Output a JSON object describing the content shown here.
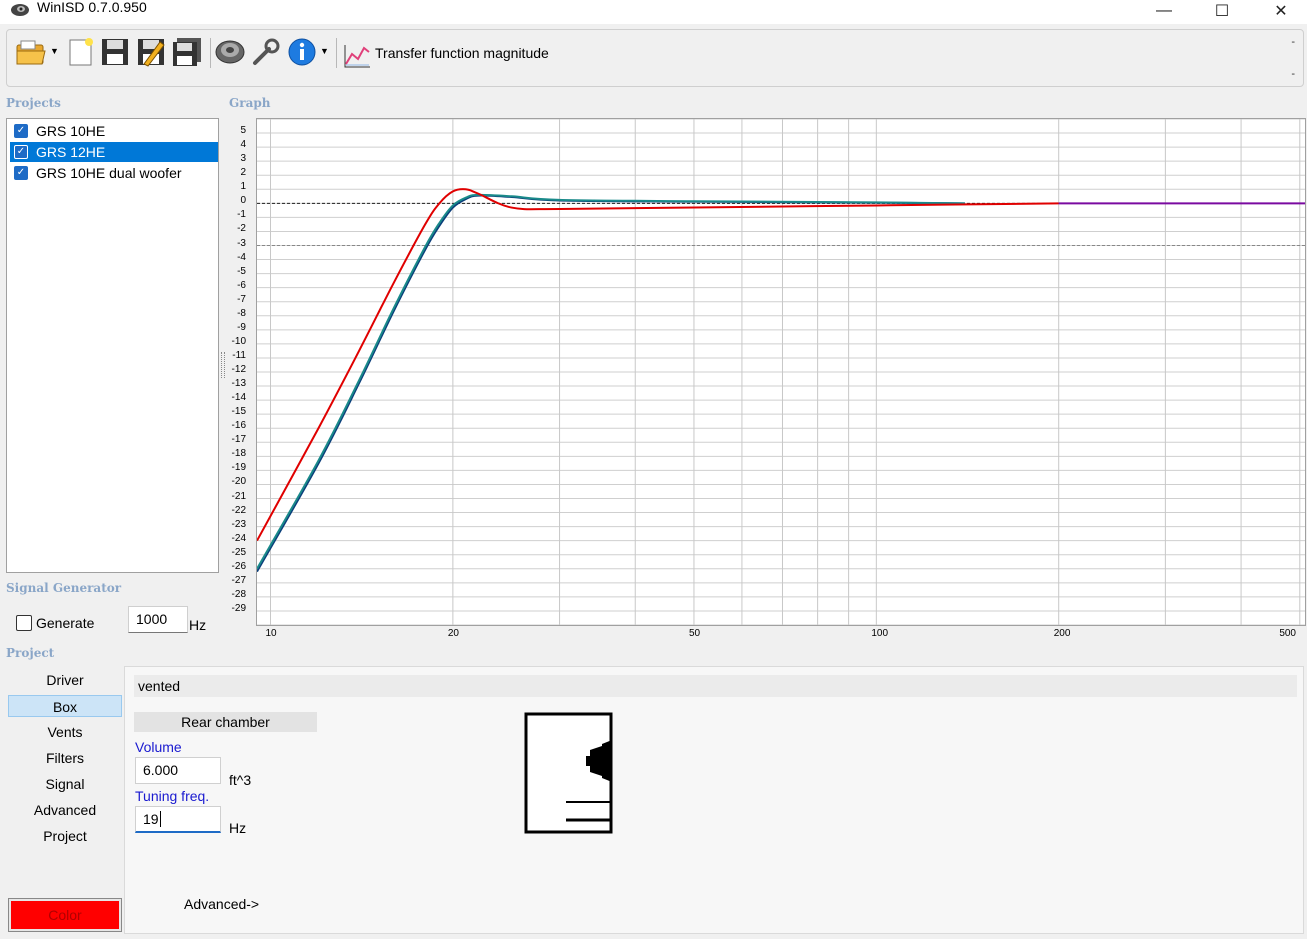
{
  "window": {
    "title": "WinISD 0.7.0.950",
    "minimize_glyph": "—",
    "maximize_glyph": "☐",
    "close_glyph": "✕"
  },
  "toolbar": {
    "icons": [
      "open-folder-icon",
      "new-document-icon",
      "save-icon",
      "save-as-icon",
      "save-all-icon",
      "speaker-driver-icon",
      "wrench-icon",
      "info-icon",
      "graph-icon"
    ],
    "dropdown_glyph": "▼",
    "graph_label": "Transfer function magnitude",
    "dash_top": "-",
    "dash_bottom": "-"
  },
  "sections": {
    "projects": "Projects",
    "graph": "Graph",
    "signal_generator": "Signal Generator",
    "project": "Project"
  },
  "projects": [
    {
      "name": "GRS 10HE",
      "checked": true,
      "selected": false
    },
    {
      "name": "GRS 12HE",
      "checked": true,
      "selected": true
    },
    {
      "name": "GRS 10HE dual woofer",
      "checked": true,
      "selected": false
    }
  ],
  "check_glyph": "✓",
  "signal_generator": {
    "generate_label": "Generate",
    "generate_checked": false,
    "frequency_value": "1000",
    "frequency_unit": "Hz"
  },
  "project_nav": [
    "Driver",
    "Box",
    "Vents",
    "Filters",
    "Signal",
    "Advanced",
    "Project"
  ],
  "project_nav_selected": "Box",
  "color_button_label": "Color",
  "color_button_color": "#ff0000",
  "box": {
    "type": "vented",
    "chamber_title": "Rear chamber",
    "volume_label": "Volume",
    "volume_value": "6.000",
    "volume_unit": "ft^3",
    "tuning_label": "Tuning freq.",
    "tuning_value": "19",
    "tuning_unit": "Hz",
    "advanced_link": "Advanced->"
  },
  "chart_data": {
    "type": "line",
    "title": "",
    "xlabel": "",
    "ylabel": "",
    "x_scale": "log",
    "xlim": [
      9.5,
      510
    ],
    "ylim": [
      -30,
      6
    ],
    "x_ticks": [
      10,
      20,
      50,
      100,
      200,
      500
    ],
    "y_ticks": [
      5,
      4,
      3,
      2,
      1,
      0,
      -1,
      -2,
      -3,
      -4,
      -5,
      -6,
      -7,
      -8,
      -9,
      -10,
      -11,
      -12,
      -13,
      -14,
      -15,
      -16,
      -17,
      -18,
      -19,
      -20,
      -21,
      -22,
      -23,
      -24,
      -25,
      -26,
      -27,
      -28,
      -29
    ],
    "reference_lines": [
      0,
      -3
    ],
    "grid": true,
    "series": [
      {
        "color": "#0a3d7a",
        "x": [
          9.5,
          12,
          14,
          16,
          18,
          19,
          20,
          21,
          22,
          25,
          30,
          50,
          100,
          140
        ],
        "y": [
          -26.2,
          -18.5,
          -12.8,
          -7.6,
          -3.3,
          -1.6,
          -0.3,
          0.3,
          0.55,
          0.45,
          0.2,
          0.12,
          0.05,
          0.0
        ]
      },
      {
        "color": "#1a8a8a",
        "x": [
          9.5,
          12,
          14,
          16,
          18,
          19,
          20,
          21,
          22,
          25,
          30,
          50,
          100,
          140
        ],
        "y": [
          -26.0,
          -18.3,
          -12.6,
          -7.4,
          -3.1,
          -1.4,
          -0.15,
          0.4,
          0.6,
          0.5,
          0.25,
          0.15,
          0.07,
          0.0
        ]
      },
      {
        "color": "#e00000",
        "x": [
          9.5,
          12,
          14,
          16,
          18,
          19,
          20,
          21,
          22,
          25,
          30,
          50,
          100,
          200
        ],
        "y": [
          -24.0,
          -16.0,
          -10.5,
          -5.6,
          -1.5,
          0.0,
          0.85,
          1.0,
          0.7,
          -0.3,
          -0.4,
          -0.3,
          -0.15,
          0.0
        ]
      },
      {
        "color": "#7a0aa0",
        "x": [
          200,
          300,
          510
        ],
        "y": [
          0.0,
          0.0,
          0.0
        ]
      }
    ]
  }
}
